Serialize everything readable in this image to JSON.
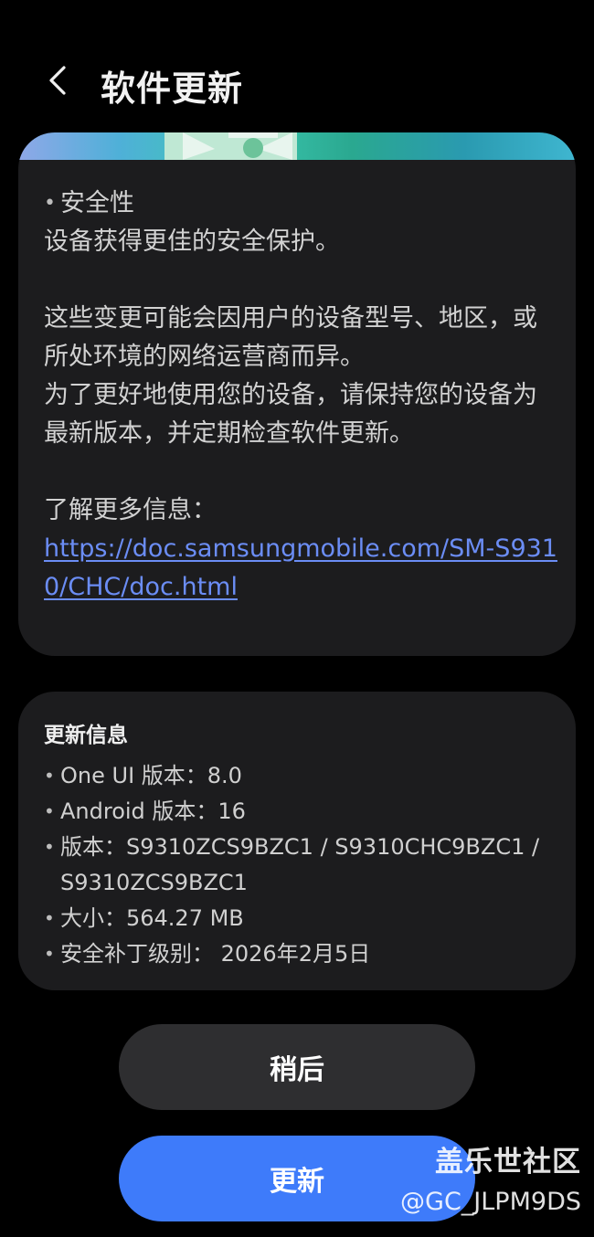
{
  "header": {
    "title": "软件更新",
    "back_icon": "chevron-left-icon"
  },
  "notes_card": {
    "security_heading": "安全性",
    "security_text": "设备获得更佳的安全保护。",
    "disclaimer": "这些变更可能会因用户的设备型号、地区，或所处环境的网络运营商而异。",
    "advice": "为了更好地使用您的设备，请保持您的设备为最新版本，并定期检查软件更新。",
    "more_info_label": "了解更多信息：",
    "link_text": "https://doc.samsungmobile.com/SM-S9310/CHC/doc.html"
  },
  "update_info": {
    "title": "更新信息",
    "items": [
      "One UI 版本：8.0",
      "Android 版本：16",
      "版本：S9310ZCS9BZC1 / S9310CHC9BZC1 / S9310ZCS9BZC1",
      "大小：564.27 MB",
      "安全补丁级别： 2026年2月5日"
    ]
  },
  "actions": {
    "later_label": "稍后",
    "update_label": "更新"
  },
  "watermark": {
    "line1": "盖乐世社区",
    "line2": "@GC_JLPM9DS"
  },
  "colors": {
    "background": "#000000",
    "card": "#1c1c1e",
    "link": "#6b8df5",
    "primary_button": "#3e7bfa",
    "secondary_button": "#2e2e30"
  }
}
